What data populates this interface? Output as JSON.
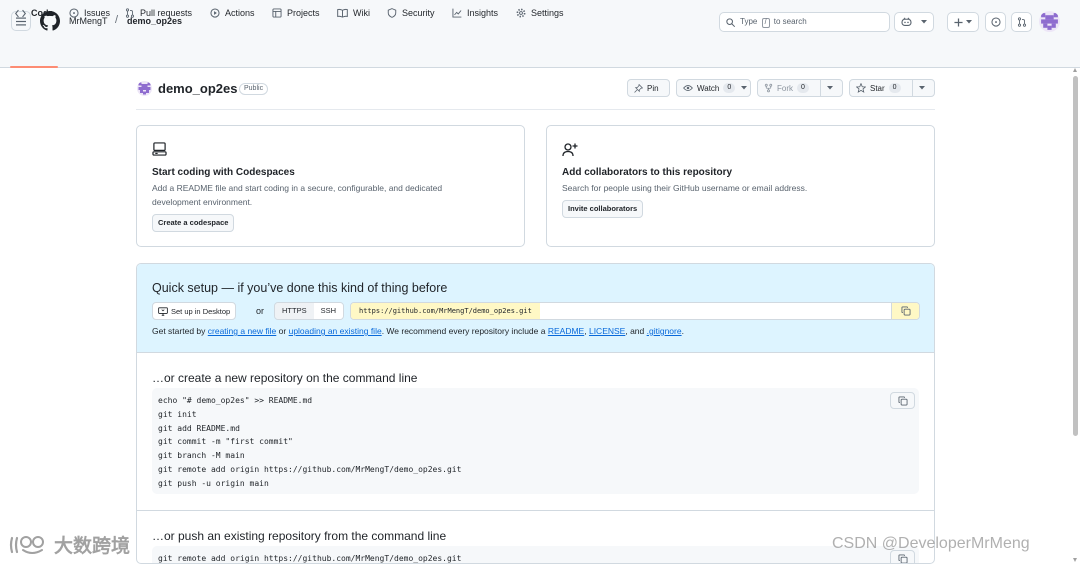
{
  "header": {
    "owner": "MrMengT",
    "separator": "/",
    "repo": "demo_op2es",
    "search": {
      "prefix": "Type",
      "key": "/",
      "suffix": "to search"
    },
    "icons": [
      "hamburger-icon",
      "github-logo",
      "search-icon",
      "copilot-icon",
      "plus-icon",
      "issues-icon",
      "pull-requests-icon"
    ]
  },
  "tabs": [
    {
      "label": "Code",
      "icon": "code-icon",
      "active": true
    },
    {
      "label": "Issues",
      "icon": "issue-icon"
    },
    {
      "label": "Pull requests",
      "icon": "pull-request-icon"
    },
    {
      "label": "Actions",
      "icon": "play-icon"
    },
    {
      "label": "Projects",
      "icon": "table-icon"
    },
    {
      "label": "Wiki",
      "icon": "book-icon"
    },
    {
      "label": "Security",
      "icon": "shield-icon"
    },
    {
      "label": "Insights",
      "icon": "graph-icon"
    },
    {
      "label": "Settings",
      "icon": "gear-icon"
    }
  ],
  "repo": {
    "name": "demo_op2es",
    "visibility": "Public",
    "pin_label": "Pin",
    "watch_label": "Watch",
    "watch_count": "0",
    "fork_label": "Fork",
    "fork_count": "0",
    "star_label": "Star",
    "star_count": "0"
  },
  "cards": {
    "codespaces": {
      "title": "Start coding with Codespaces",
      "desc": "Add a README file and start coding in a secure, configurable, and dedicated development environment.",
      "button": "Create a codespace"
    },
    "collaborators": {
      "title": "Add collaborators to this repository",
      "desc": "Search for people using their GitHub username or email address.",
      "button": "Invite collaborators"
    }
  },
  "quick_setup": {
    "title": "Quick setup — if you’ve done this kind of thing before",
    "desktop_button": "Set up in Desktop",
    "or": "or",
    "https": "HTTPS",
    "ssh": "SSH",
    "url": "https://github.com/MrMengT/demo_op2es.git",
    "help_prefix": "Get started by",
    "link_new_file": "creating a new file",
    "help_or": "or",
    "link_upload": "uploading an existing file",
    "help_mid": ". We recommend every repository include a",
    "link_readme": "README",
    "comma": ",",
    "link_license": "LICENSE",
    "help_and": ", and",
    "link_gitignore": ".gitignore",
    "period": "."
  },
  "sections": {
    "new_repo": {
      "title": "…or create a new repository on the command line",
      "code": "echo \"# demo_op2es\" >> README.md\ngit init\ngit add README.md\ngit commit -m \"first commit\"\ngit branch -M main\ngit remote add origin https://github.com/MrMengT/demo_op2es.git\ngit push -u origin main"
    },
    "push_existing": {
      "title": "…or push an existing repository from the command line",
      "code": "git remote add origin https://github.com/MrMengT/demo_op2es.git"
    }
  },
  "watermarks": {
    "left": "大数跨境",
    "right": "CSDN @DeveloperMrMeng"
  }
}
